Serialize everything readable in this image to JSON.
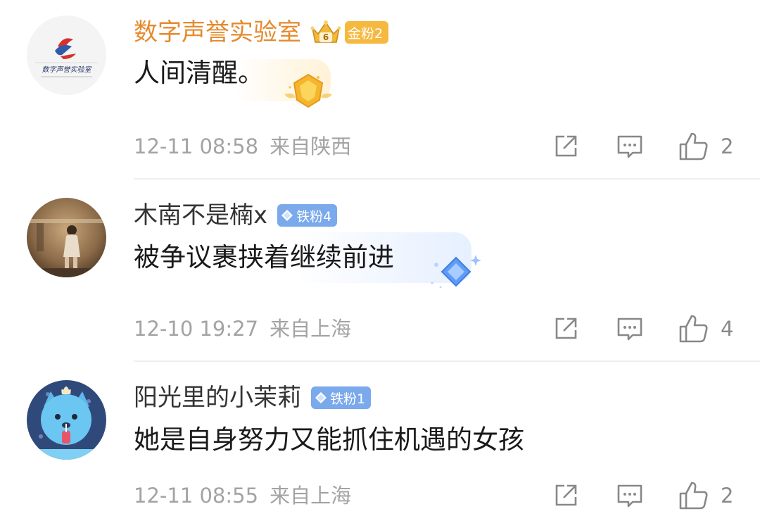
{
  "colors": {
    "gold_name": "#e58a2e",
    "plain_name": "#333333",
    "gold_badge": "#f6b940",
    "blue_badge": "#7aa9ec",
    "meta": "#a3a3a3",
    "icon": "#888888"
  },
  "comments": [
    {
      "username": "数字声誉实验室",
      "avatar_text": "数字声誉实验室",
      "crown_level": "6",
      "badge": "金粉2",
      "badge_icon": "gold-fan-icon",
      "text": "人间清醒。",
      "time": "12-11 08:58",
      "location": "来自陕西",
      "likes": "2"
    },
    {
      "username": "木南不是楠x",
      "badge": "铁粉4",
      "badge_icon": "diamond-icon",
      "text": "被争议裹挟着继续前进",
      "time": "12-10 19:27",
      "location": "来自上海",
      "likes": "4"
    },
    {
      "username": "阳光里的小茉莉",
      "badge": "铁粉1",
      "badge_icon": "diamond-icon",
      "text": "她是自身努力又能抓住机遇的女孩",
      "time": "12-11 08:55",
      "location": "来自上海",
      "likes": "2"
    }
  ]
}
